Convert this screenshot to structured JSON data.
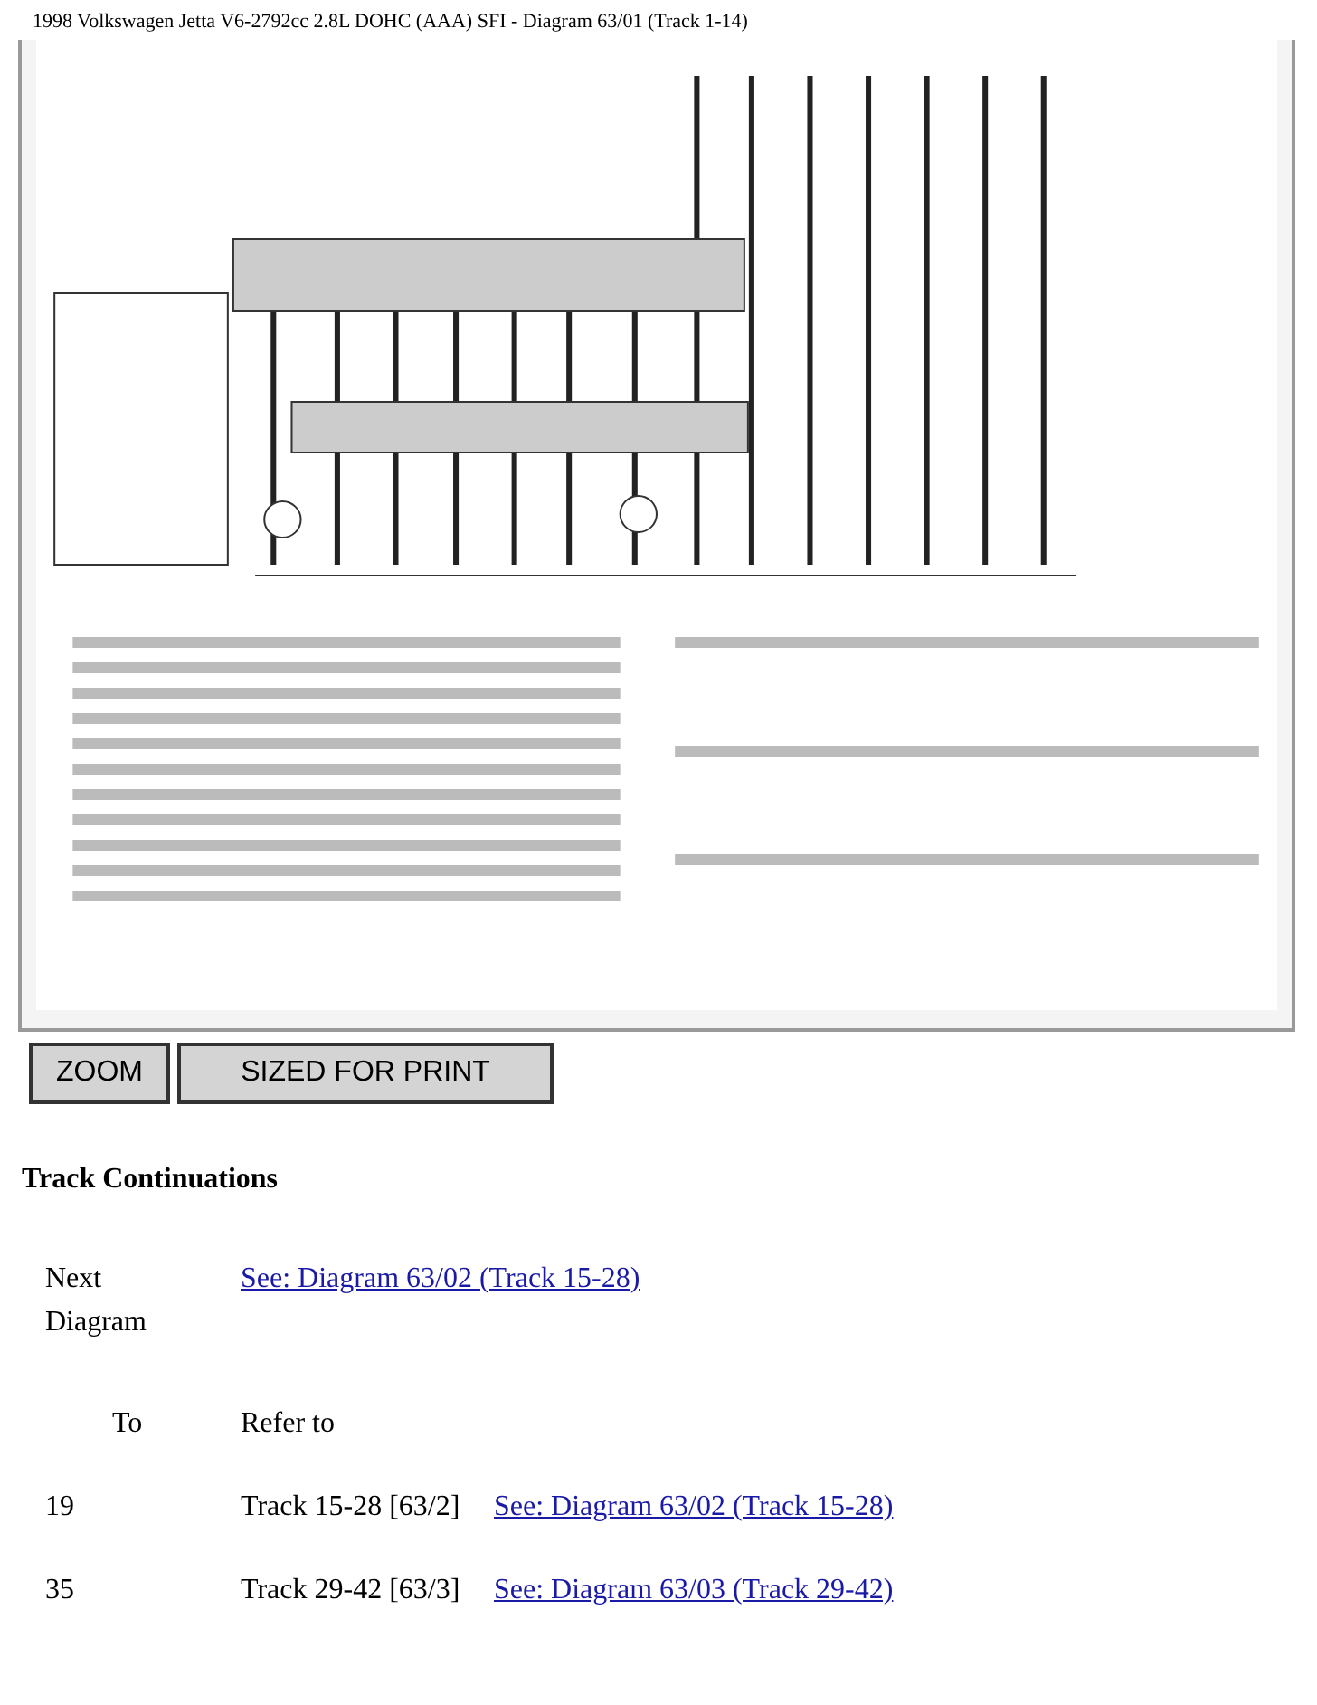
{
  "page_title": "1998 Volkswagen Jetta V6-2792cc 2.8L DOHC (AAA) SFI - Diagram 63/01 (Track 1-14)",
  "buttons": [
    "ZOOM",
    "SIZED FOR PRINT"
  ],
  "section_heading": "Track Continuations",
  "next": {
    "label": "Next Diagram",
    "link": "See: Diagram 63/02 (Track 15-28)"
  },
  "table": {
    "columns": [
      "To",
      "Refer to"
    ],
    "rows": [
      {
        "to": "19",
        "track": "Track 15-28 [63/2]",
        "link": "See: Diagram 63/02 (Track 15-28)"
      },
      {
        "to": "35",
        "track": "Track 29-42 [63/3]",
        "link": "See: Diagram 63/03 (Track 29-42)"
      }
    ]
  }
}
